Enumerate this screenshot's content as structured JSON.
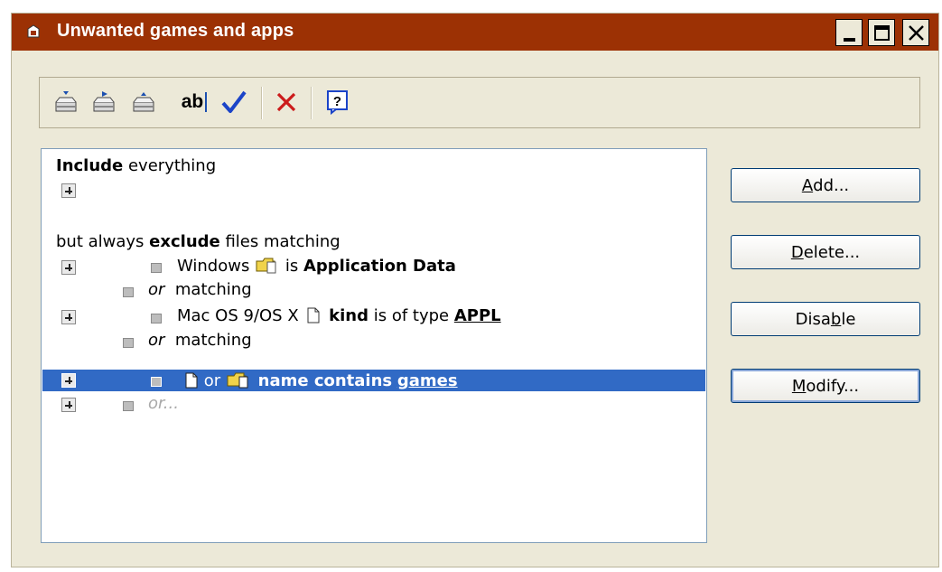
{
  "window": {
    "title": "Unwanted games and apps",
    "controls": [
      "minimize",
      "maximize",
      "close"
    ]
  },
  "toolbar": {
    "items": [
      {
        "icon": "tray-in-icon"
      },
      {
        "icon": "tray-out-icon"
      },
      {
        "icon": "tray-up-icon"
      },
      {
        "icon": "rename-icon",
        "label": "ab"
      },
      {
        "icon": "checkmark-icon"
      },
      {
        "icon": "delete-x-icon"
      },
      {
        "icon": "help-icon",
        "label": "?"
      }
    ]
  },
  "rules": {
    "include_bold": "Include",
    "include_rest": " everything",
    "exclude_prefix": "but always ",
    "exclude_bold": "exclude",
    "exclude_suffix": " files matching",
    "row1": {
      "platform": "Windows",
      "verb": "is",
      "value": "Application Data"
    },
    "or_label": "or",
    "matching_label": "matching",
    "row2": {
      "platform": "Mac OS 9/OS X",
      "field": "kind",
      "verb": "is of type",
      "value": "APPL"
    },
    "row3": {
      "connector": "or",
      "field": "name contains",
      "value": "games"
    },
    "row4": {
      "placeholder": "or..."
    }
  },
  "buttons": {
    "add": {
      "pre": "",
      "mnemonic": "A",
      "post": "dd..."
    },
    "delete": {
      "pre": "",
      "mnemonic": "D",
      "post": "elete..."
    },
    "disable": {
      "pre": "Disa",
      "mnemonic": "b",
      "post": "le"
    },
    "modify": {
      "pre": "",
      "mnemonic": "M",
      "post": "odify..."
    }
  },
  "colors": {
    "titlebar": "#9C3104",
    "selection": "#316AC5",
    "window_bg": "#ECE9D8"
  }
}
